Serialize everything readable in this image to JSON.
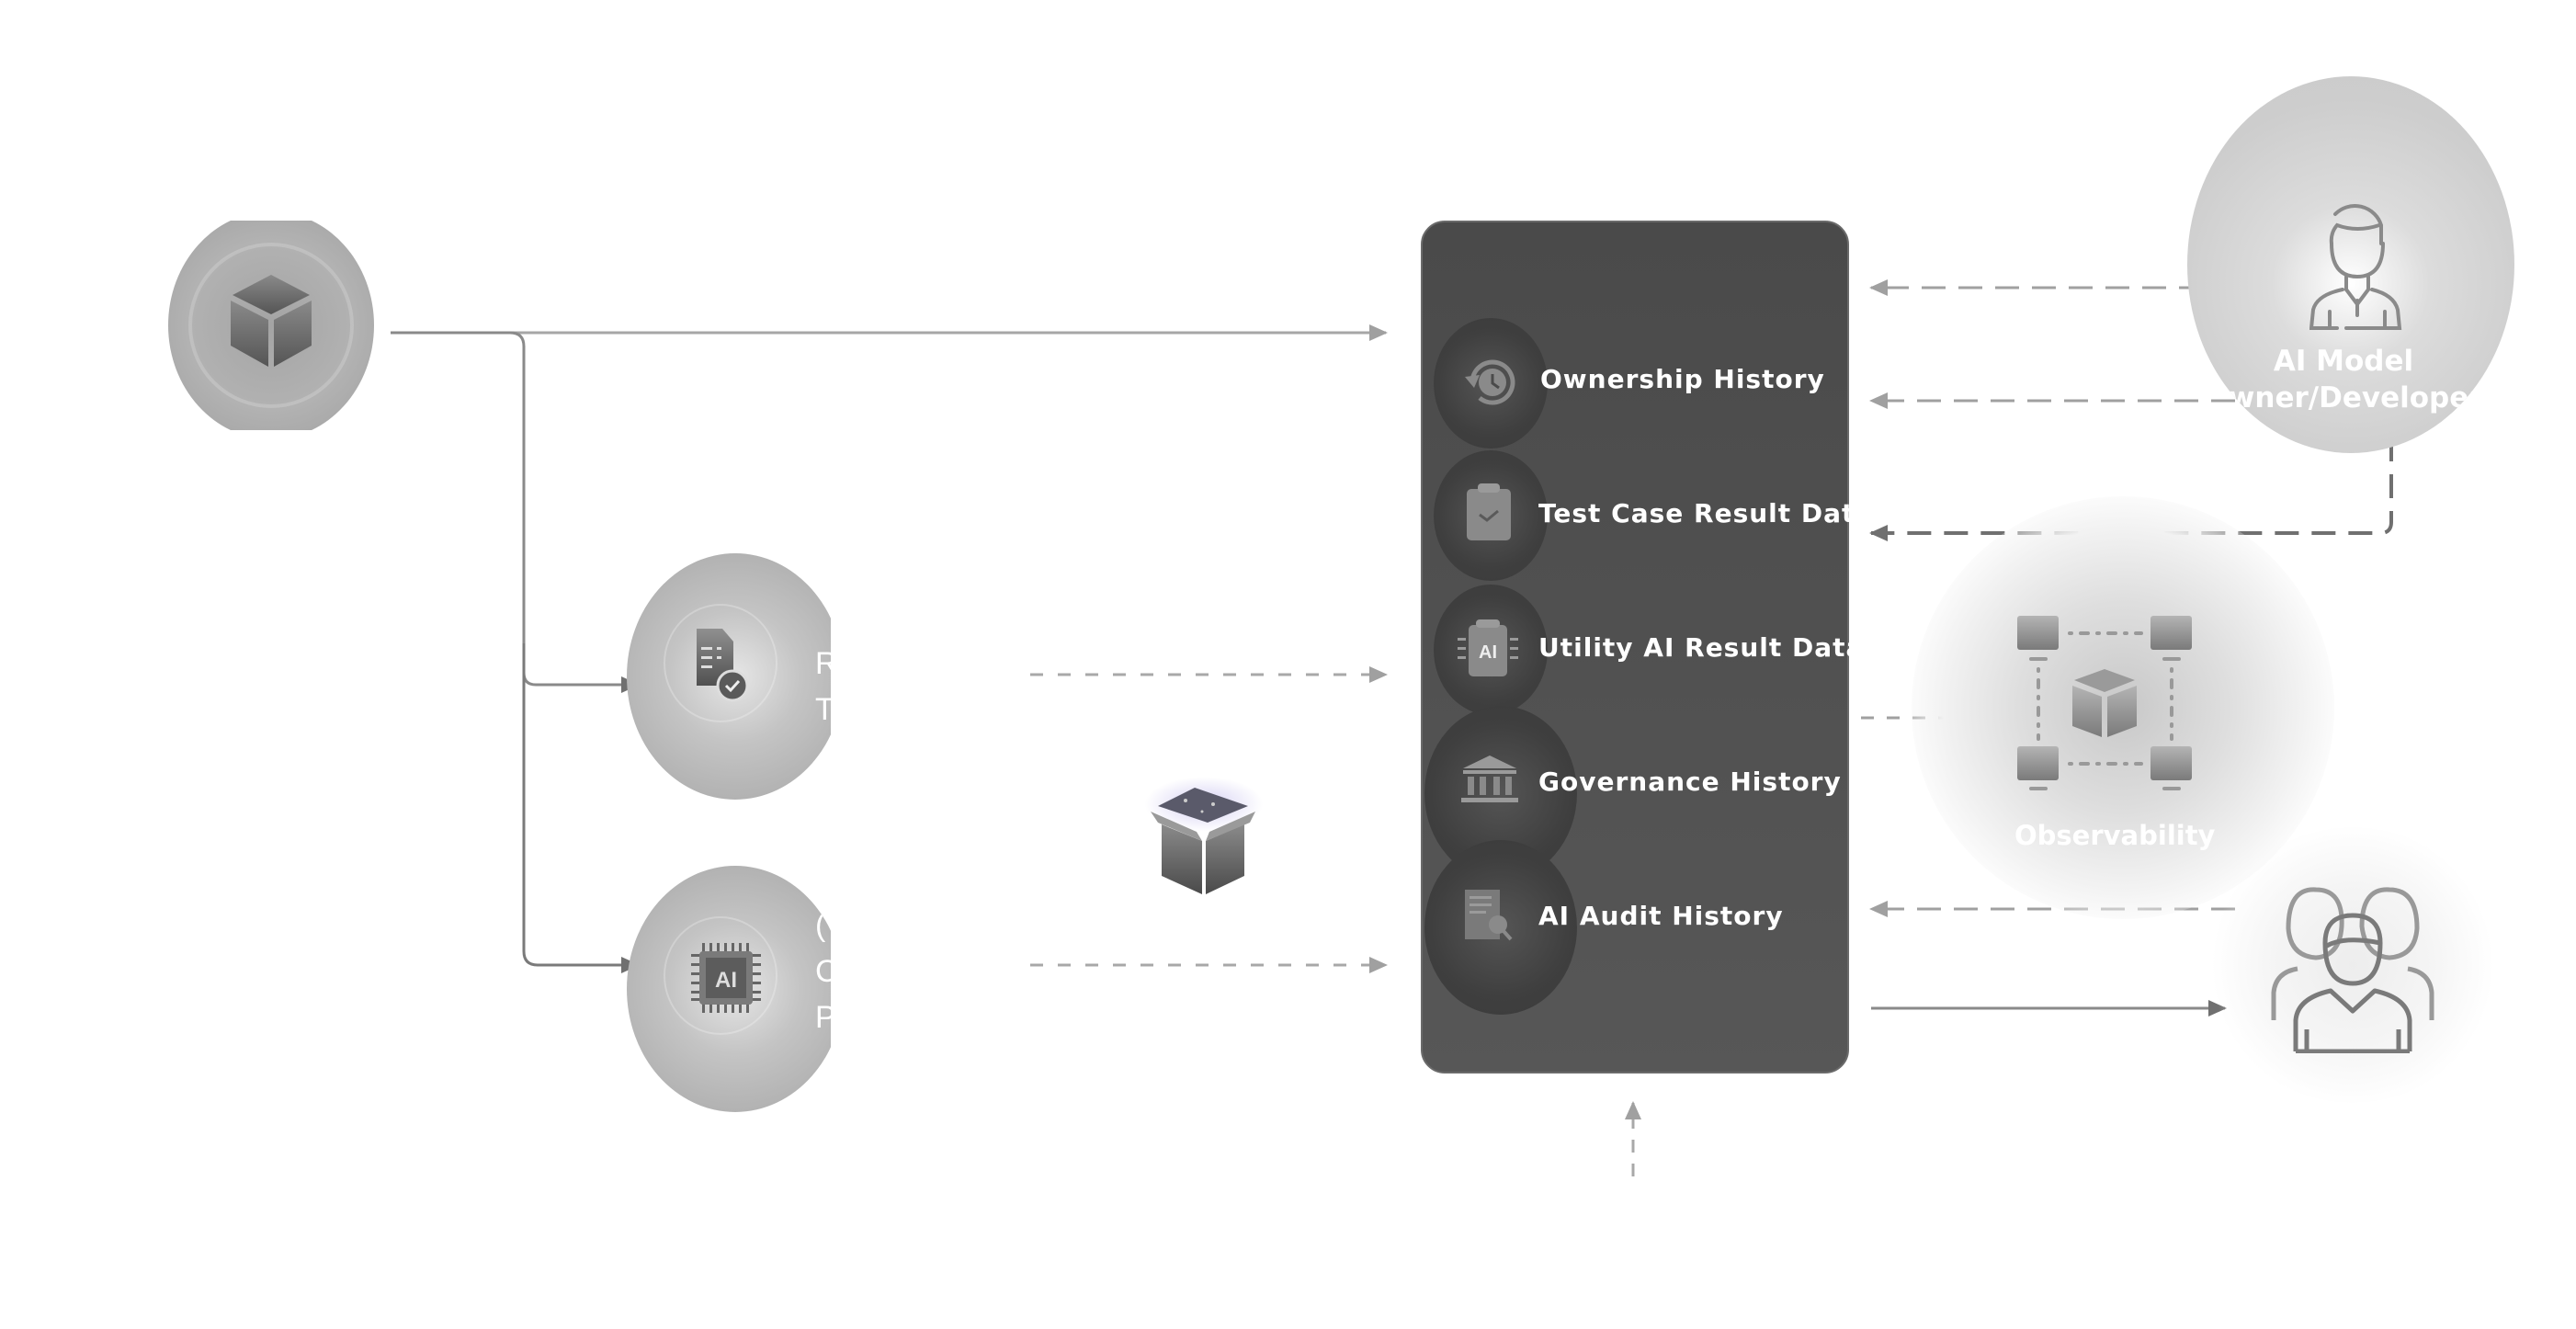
{
  "nodes": {
    "source": {
      "icon": "cube-icon"
    },
    "test_node": {
      "icon": "document-check-icon",
      "label_lines": [
        "R",
        "T"
      ]
    },
    "ai_node": {
      "icon": "ai-chip-icon",
      "label_lines": [
        "(",
        "C",
        "P"
      ]
    },
    "package": {
      "icon": "open-box-icon"
    }
  },
  "panel": {
    "items": [
      {
        "label": "Ownership History",
        "icon": "history-clock-icon"
      },
      {
        "label": "Test Case Result Data",
        "icon": "clipboard-check-icon"
      },
      {
        "label": "Utility AI  Result Data",
        "icon": "ai-clipboard-icon"
      },
      {
        "label": "Governance History",
        "icon": "bank-icon"
      },
      {
        "label": "AI Audit History",
        "icon": "audit-document-icon"
      }
    ]
  },
  "owner": {
    "label_line1": "AI Model",
    "label_line2": "Owner/Developer",
    "icon": "person-icon"
  },
  "observability": {
    "label": "Observability",
    "icon": "network-cube-icon"
  },
  "users": {
    "icon": "users-group-icon"
  },
  "colors": {
    "panel": "#4f4f4f",
    "node": "#b8b8b8",
    "line": "#8a8a8a",
    "text": "#ffffff"
  }
}
